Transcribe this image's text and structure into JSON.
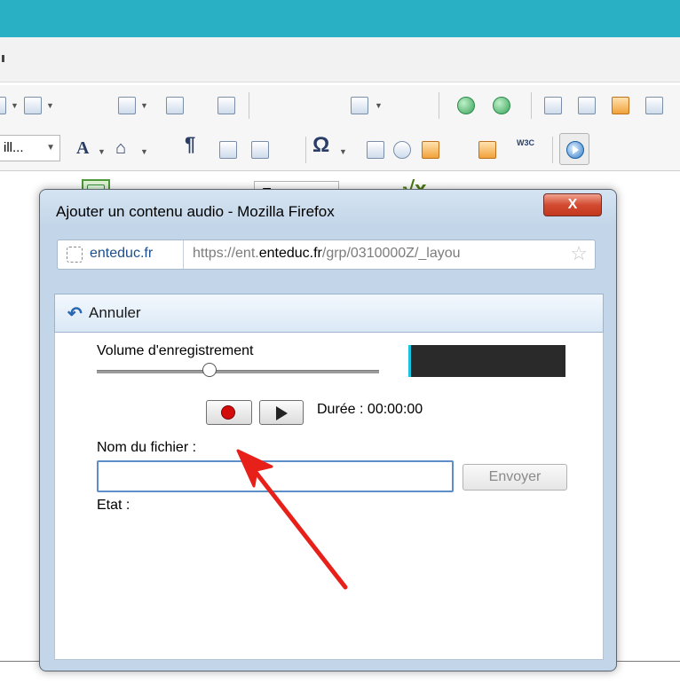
{
  "toolbar": {
    "zoom_label": "Zoom",
    "font_label": "ill..."
  },
  "dialog": {
    "title": "Ajouter un contenu audio - Mozilla Firefox",
    "close_label": "X",
    "urlbar": {
      "site": "enteduc.fr",
      "url_prefix": "https://ent.",
      "url_domain": "enteduc.fr",
      "url_suffix": "/grp/0310000Z/_layou"
    },
    "cancel_label": "Annuler",
    "volume_label": "Volume d'enregistrement",
    "volume_level": 0.4,
    "duration_text": "Durée : 00:00:00",
    "file_label": "Nom du fichier :",
    "file_value": "",
    "send_label": "Envoyer",
    "state_label": "Etat :"
  },
  "colors": {
    "top_band": "#2ab0c4",
    "annotation_arrow": "#e8201a",
    "record_dot": "#d40b0b"
  },
  "icons": [
    "table-icon",
    "edit-icon",
    "select-icon",
    "insert-row-icon",
    "grid-icon",
    "columns-icon",
    "connector-icon",
    "sqrt-icon",
    "globe-icon",
    "image-icon",
    "font-color-icon",
    "paint-icon",
    "pilcrow-icon",
    "paste-icon",
    "align-icon",
    "omega-icon",
    "form-icon",
    "clock-icon",
    "cleaner-icon",
    "blocks-icon",
    "w3c-icon",
    "media-icon",
    "record-icon",
    "play-icon",
    "undo-icon",
    "star-icon"
  ]
}
